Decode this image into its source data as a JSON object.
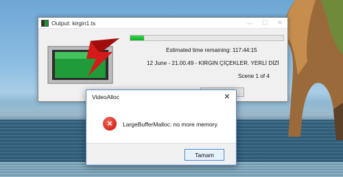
{
  "main_window": {
    "title": "Output: kirgin1.ts",
    "progress_fraction": 0.09,
    "eta_text": "Estimated time remaining: 117:44:15",
    "program_text": "12 June - 21.00.49 - KIRGIN ÇİÇEKLER. YERLİ DİZİ",
    "scene_text": "Scene 1 of 4"
  },
  "dialog": {
    "title": "VideoAlloc",
    "message": "LargeBufferMalloc: no more memory.",
    "ok_label": "Tamam",
    "close_glyph": "✕",
    "icon": "error-icon"
  },
  "colors": {
    "progress": "#06b025",
    "error": "#d9271c",
    "dialog_border": "#5a8fd0"
  }
}
